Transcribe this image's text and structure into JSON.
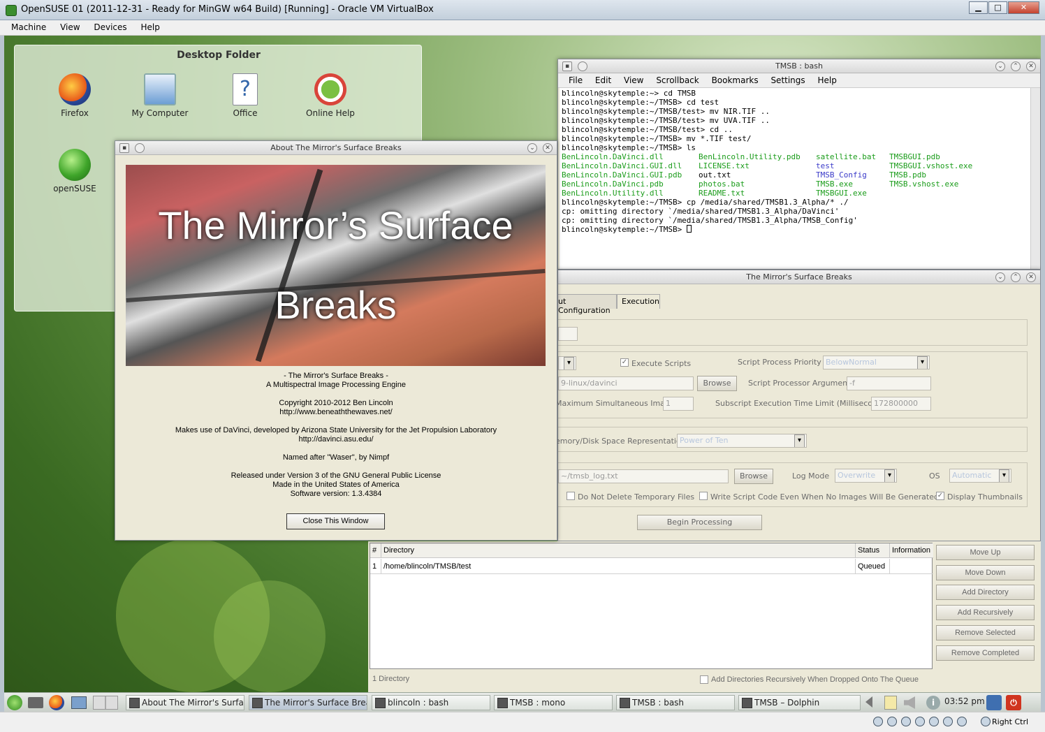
{
  "host": {
    "title": "OpenSUSE 01 (2011-12-31 - Ready for MinGW w64 Build) [Running] - Oracle VM VirtualBox",
    "menu": [
      "Machine",
      "View",
      "Devices",
      "Help"
    ],
    "host_key": "Right Ctrl"
  },
  "desktop": {
    "folder_title": "Desktop Folder",
    "icons": [
      "Firefox",
      "My Computer",
      "Office",
      "Online Help",
      "openSUSE"
    ]
  },
  "terminal": {
    "title": "TMSB : bash",
    "menu": [
      "File",
      "Edit",
      "View",
      "Scrollback",
      "Bookmarks",
      "Settings",
      "Help"
    ],
    "lines": [
      "blincoln@skytemple:~> cd TMSB",
      "blincoln@skytemple:~/TMSB> cd test",
      "blincoln@skytemple:~/TMSB/test> mv NIR.TIF ..",
      "blincoln@skytemple:~/TMSB/test> mv UVA.TIF ..",
      "blincoln@skytemple:~/TMSB/test> cd ..",
      "blincoln@skytemple:~/TMSB> mv *.TIF test/",
      "blincoln@skytemple:~/TMSB> ls"
    ],
    "ls_rows": [
      [
        "BenLincoln.DaVinci.dll",
        "BenLincoln.Utility.pdb",
        "satellite.bat",
        "TMSBGUI.pdb"
      ],
      [
        "BenLincoln.DaVinci.GUI.dll",
        "LICENSE.txt",
        "test",
        "TMSBGUI.vshost.exe"
      ],
      [
        "BenLincoln.DaVinci.GUI.pdb",
        "out.txt",
        "TMSB_Config",
        "TMSB.pdb"
      ],
      [
        "BenLincoln.DaVinci.pdb",
        "photos.bat",
        "TMSB.exe",
        "TMSB.vshost.exe"
      ],
      [
        "BenLincoln.Utility.dll",
        "README.txt",
        "TMSBGUI.exe",
        ""
      ]
    ],
    "after_lines": [
      "blincoln@skytemple:~/TMSB> cp /media/shared/TMSB1.3_Alpha/* ./",
      "cp: omitting directory `/media/shared/TMSB1.3_Alpha/DaVinci'",
      "cp: omitting directory `/media/shared/TMSB1.3_Alpha/TMSB_Config'",
      "blincoln@skytemple:~/TMSB> "
    ]
  },
  "tmsb": {
    "title": "The Mirror's Surface Breaks",
    "tabs": [
      "ut Configuration",
      "Execution"
    ],
    "execute_scripts": "Execute Scripts",
    "script_priority_label": "Script Process Priority",
    "script_priority_value": "BelowNormal",
    "davinci_path": "9-linux/davinci",
    "browse": "Browse",
    "script_args_label": "Script Processor Arguments",
    "script_args_value": "-f",
    "max_images_label": "Maximum Simultaneous Images",
    "max_images_value": "1",
    "time_limit_label": "Subscript Execution Time Limit (Milliseconds)",
    "time_limit_value": "172800000",
    "memory_label": "emory/Disk Space Representation",
    "memory_value": "Power of Ten",
    "log_path": "~/tmsb_log.txt",
    "log_mode_label": "Log Mode",
    "log_mode_value": "Overwrite",
    "os_label": "OS",
    "os_value": "Automatic",
    "no_delete_temp": "Do Not Delete Temporary Files",
    "write_script": "Write Script Code Even When No Images Will Be Generated",
    "display_thumbs": "Display Thumbnails",
    "begin": "Begin Processing"
  },
  "queue": {
    "headers": [
      "#",
      "Directory",
      "Status",
      "Information"
    ],
    "rows": [
      [
        "1",
        "/home/blincoln/TMSB/test",
        "Queued",
        ""
      ]
    ],
    "buttons": [
      "Move Up",
      "Move Down",
      "Add Directory",
      "Add Recursively",
      "Remove Selected",
      "Remove Completed"
    ],
    "count": "1 Directory",
    "recursive_drop": "Add Directories Recursively When Dropped Onto The Queue"
  },
  "about": {
    "title": "About The Mirror's Surface Breaks",
    "banner_line1": "The Mirror’s Surface",
    "banner_line2": "Breaks",
    "l1": "- The Mirror's Surface Breaks -",
    "l2": "A Multispectral Image Processing Engine",
    "l3": "Copyright 2010-2012 Ben Lincoln",
    "l4": "http://www.beneaththewaves.net/",
    "l5": "Makes use of DaVinci, developed by Arizona State University for the Jet Propulsion Laboratory",
    "l6": "http://davinci.asu.edu/",
    "l7": "Named after \"Waser\", by Nimpf",
    "l8": "Released under Version 3 of the GNU General Public License",
    "l9": "Made in the United States of America",
    "l10": "Software version: 1.3.4384",
    "close": "Close This Window"
  },
  "taskbar": {
    "tasks": [
      "About The Mirror's Surfac",
      "The Mirror's Surface Brea",
      "blincoln : bash",
      "TMSB : mono",
      "TMSB : bash",
      "TMSB – Dolphin"
    ],
    "clock": "03:52 pm"
  }
}
